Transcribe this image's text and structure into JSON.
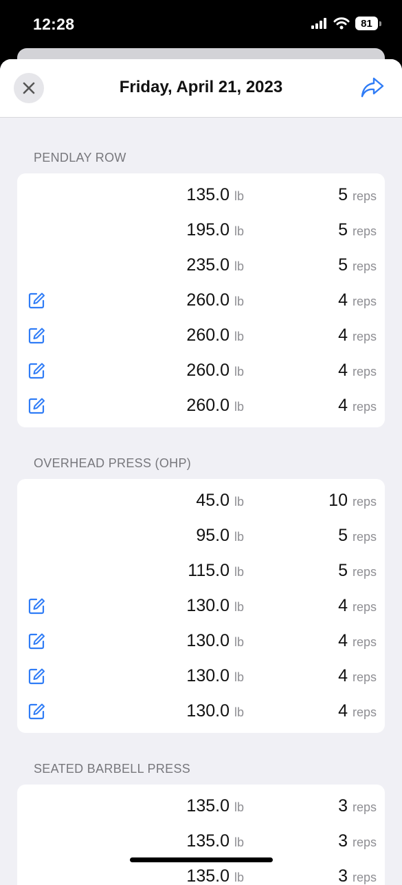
{
  "status_bar": {
    "time": "12:28",
    "battery": "81"
  },
  "header": {
    "title": "Friday, April 21, 2023"
  },
  "sections": [
    {
      "name": "PENDLAY ROW",
      "sets": [
        {
          "weight": "135.0",
          "unit": "lb",
          "reps": "5",
          "reps_label": "reps",
          "edited": false
        },
        {
          "weight": "195.0",
          "unit": "lb",
          "reps": "5",
          "reps_label": "reps",
          "edited": false
        },
        {
          "weight": "235.0",
          "unit": "lb",
          "reps": "5",
          "reps_label": "reps",
          "edited": false
        },
        {
          "weight": "260.0",
          "unit": "lb",
          "reps": "4",
          "reps_label": "reps",
          "edited": true
        },
        {
          "weight": "260.0",
          "unit": "lb",
          "reps": "4",
          "reps_label": "reps",
          "edited": true
        },
        {
          "weight": "260.0",
          "unit": "lb",
          "reps": "4",
          "reps_label": "reps",
          "edited": true
        },
        {
          "weight": "260.0",
          "unit": "lb",
          "reps": "4",
          "reps_label": "reps",
          "edited": true
        }
      ]
    },
    {
      "name": "OVERHEAD PRESS (OHP)",
      "sets": [
        {
          "weight": "45.0",
          "unit": "lb",
          "reps": "10",
          "reps_label": "reps",
          "edited": false
        },
        {
          "weight": "95.0",
          "unit": "lb",
          "reps": "5",
          "reps_label": "reps",
          "edited": false
        },
        {
          "weight": "115.0",
          "unit": "lb",
          "reps": "5",
          "reps_label": "reps",
          "edited": false
        },
        {
          "weight": "130.0",
          "unit": "lb",
          "reps": "4",
          "reps_label": "reps",
          "edited": true
        },
        {
          "weight": "130.0",
          "unit": "lb",
          "reps": "4",
          "reps_label": "reps",
          "edited": true
        },
        {
          "weight": "130.0",
          "unit": "lb",
          "reps": "4",
          "reps_label": "reps",
          "edited": true
        },
        {
          "weight": "130.0",
          "unit": "lb",
          "reps": "4",
          "reps_label": "reps",
          "edited": true
        }
      ]
    },
    {
      "name": "SEATED BARBELL PRESS",
      "sets": [
        {
          "weight": "135.0",
          "unit": "lb",
          "reps": "3",
          "reps_label": "reps",
          "edited": false
        },
        {
          "weight": "135.0",
          "unit": "lb",
          "reps": "3",
          "reps_label": "reps",
          "edited": false
        },
        {
          "weight": "135.0",
          "unit": "lb",
          "reps": "3",
          "reps_label": "reps",
          "edited": false
        }
      ]
    }
  ],
  "colors": {
    "accent": "#2f7cf6",
    "background": "#f0f0f5",
    "card": "#ffffff",
    "secondary_text": "#8e8e93"
  },
  "icons": {
    "close": "close-icon",
    "share": "share-icon",
    "edit": "edit-icon"
  }
}
